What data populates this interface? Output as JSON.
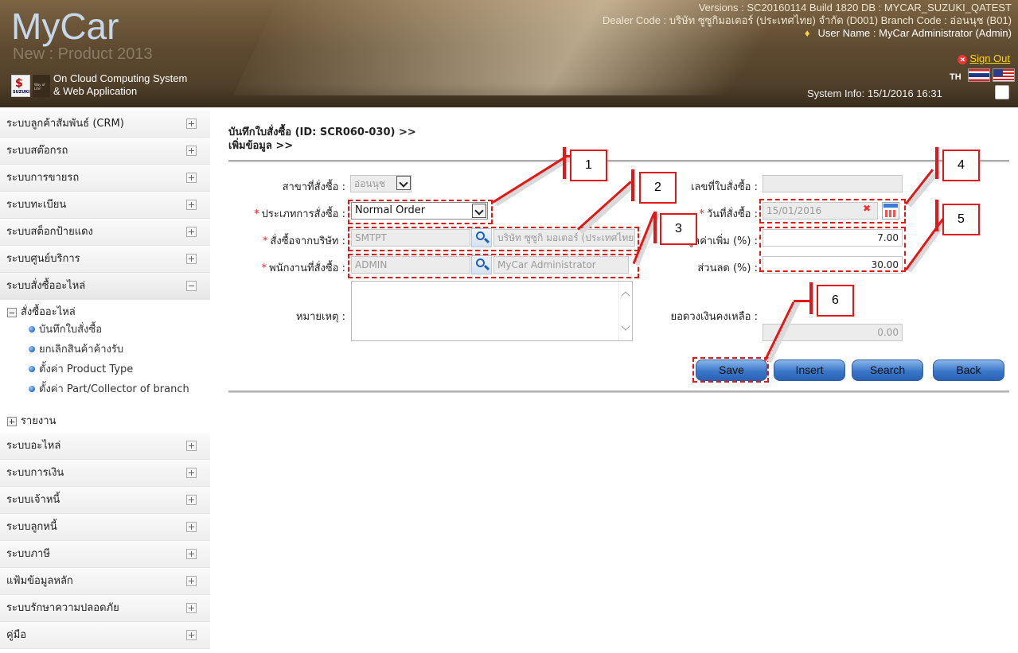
{
  "header": {
    "logo_title": "MyCar",
    "logo_subtitle": "New : Product 2013",
    "brand_small": "SUZUKI",
    "brand_tagline": "Way of Life!",
    "cloud_line1": "On Cloud Computing System",
    "cloud_line2": "& Web Application",
    "versions": "Versions : SC20160114 Build 1820 DB : MYCAR_SUZUKI_QATEST",
    "dealer": "Dealer Code : บริษัท ซูซูกิมอเตอร์ (ประเทศไทย) จำกัด (D001)  Branch Code : อ่อนนุช (B01)",
    "user": "User Name : MyCar Administrator  (Admin)",
    "sign_out": "Sign Out",
    "lang": "TH",
    "system_info": "System Info: 15/1/2016 16:31"
  },
  "sidebar": {
    "items_top": [
      {
        "label": "ระบบลูกค้าสัมพันธ์ (CRM)"
      },
      {
        "label": "ระบบสต๊อกรถ"
      },
      {
        "label": "ระบบการขายรถ"
      },
      {
        "label": "ระบบทะเบียน"
      },
      {
        "label": "ระบบสต็อกป้ายแดง"
      },
      {
        "label": "ระบบศูนย์บริการ"
      },
      {
        "label": "ระบบสั่งซื้ออะไหล่"
      }
    ],
    "tree": {
      "group": "สั่งซื้ออะไหล่",
      "leaves": [
        {
          "label": "บันทึกใบสั่งซื้อ"
        },
        {
          "label": "ยกเลิกสินค้าค้างรับ"
        },
        {
          "label": "ตั้งค่า Product Type"
        },
        {
          "label": "ตั้งค่า Part/Collector of branch"
        }
      ],
      "report": "รายงาน"
    },
    "items_bottom": [
      {
        "label": "ระบบอะไหล่"
      },
      {
        "label": "ระบบการเงิน"
      },
      {
        "label": "ระบบเจ้าหนี้"
      },
      {
        "label": "ระบบลูกหนี้"
      },
      {
        "label": "ระบบภาษี"
      },
      {
        "label": "แฟ้มข้อมูลหลัก"
      },
      {
        "label": "ระบบรักษาความปลอดภัย"
      },
      {
        "label": "คู่มือ"
      }
    ]
  },
  "main": {
    "breadcrumb1": "บันทึกใบสั่งซื้อ (ID: SCR060-030) >>",
    "breadcrumb2": "เพิ่มข้อมูล >>",
    "form": {
      "branch_label": "สาขาที่สั่งซื้อ :",
      "branch_value": "อ่อนนุช",
      "order_type_label": "ประเภทการสั่งซื้อ :",
      "order_type_value": "Normal Order",
      "supplier_label": "สั่งซื้อจากบริษัท :",
      "supplier_code": "SMTPT",
      "supplier_name": "บริษัท ซูซูกิ มอเตอร์ (ประเทศไทย) จำกัด",
      "employee_label": "พนักงานที่สั่งซื้อ :",
      "employee_code": "ADMIN",
      "employee_name": "MyCar Administrator",
      "remark_label": "หมายเหตุ :",
      "order_no_label": "เลขที่ใบสั่งซื้อ :",
      "order_no_value": "",
      "order_date_label": "วันที่สั่งซื้อ :",
      "order_date_value": "15/01/2016",
      "vat_label": "ภาษีมูลค่าเพิ่ม (%) :",
      "vat_value": "7.00",
      "discount_label": "ส่วนลด (%) :",
      "discount_value": "30.00",
      "balance_label": "ยอดวงเงินคงเหลือ :",
      "balance_value": "0.00"
    },
    "buttons": {
      "save": "Save",
      "insert": "Insert",
      "search": "Search",
      "back": "Back"
    },
    "callouts": [
      "1",
      "2",
      "3",
      "4",
      "5",
      "6"
    ]
  },
  "colors": {
    "accent_red": "#e21818",
    "button_blue": "#3b77c9",
    "header_brown": "#5d4a30"
  }
}
